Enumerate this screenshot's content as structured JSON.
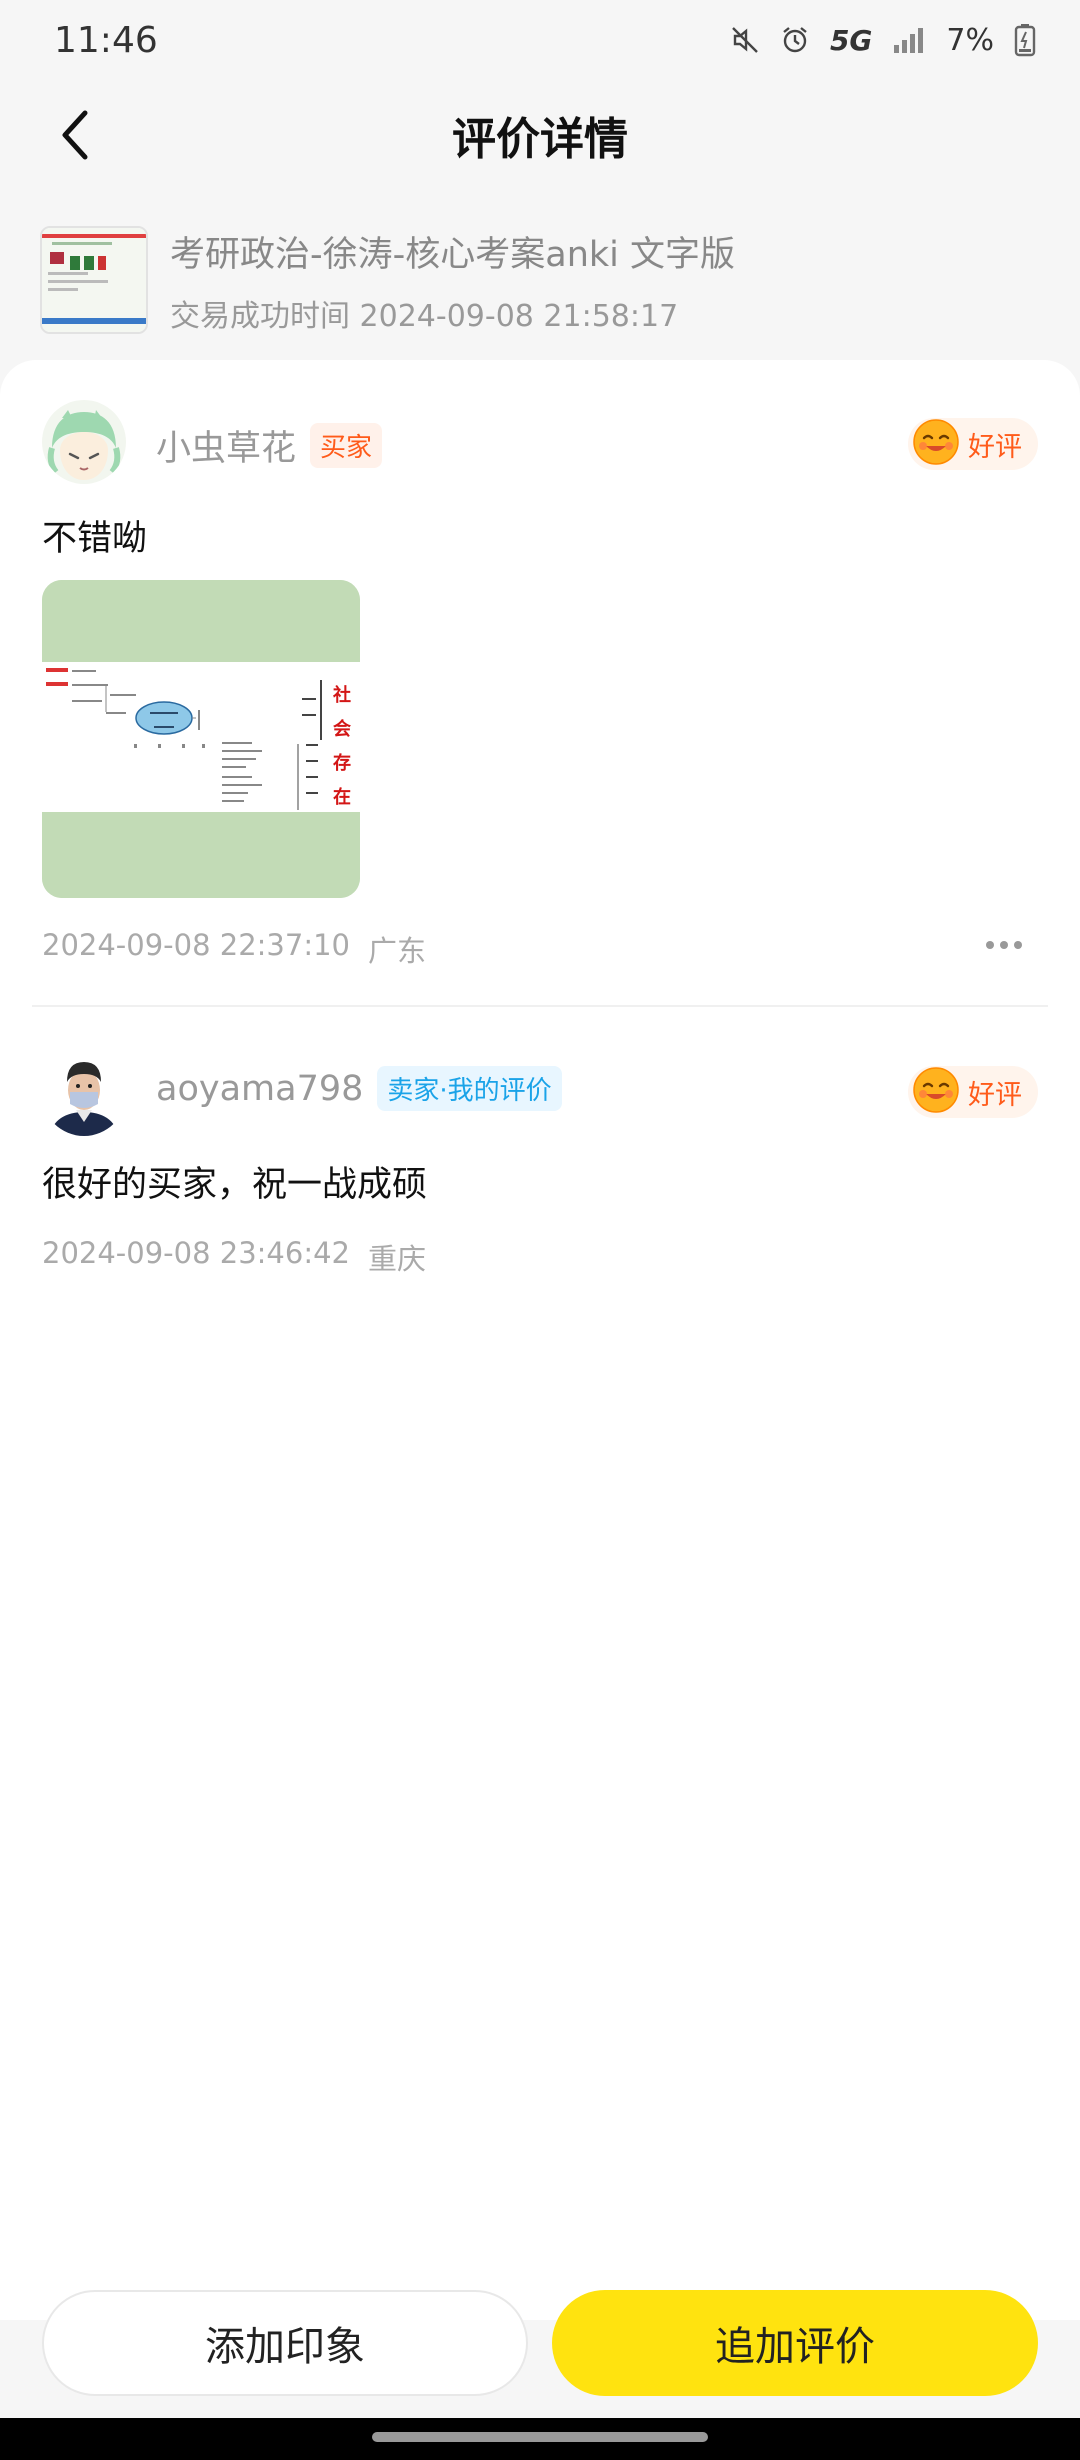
{
  "status_bar": {
    "time": "11:46",
    "network": "5G",
    "battery": "7%",
    "icons": [
      "mute-icon",
      "alarm-icon",
      "signal-icon",
      "battery-icon"
    ]
  },
  "nav": {
    "title": "评价详情",
    "back_icon": "chevron-left-icon"
  },
  "product": {
    "name": "考研政治-徐涛-核心考案anki 文字版",
    "trade_time_label": "交易成功时间",
    "trade_time": "2024-09-08 21:58:17"
  },
  "reviews": [
    {
      "username": "小虫草花",
      "role": "买家",
      "rating": "好评",
      "content": "不错呦",
      "has_image": true,
      "image_text": [
        "社",
        "会",
        "存",
        "在"
      ],
      "time": "2024-09-08 22:37:10",
      "location": "广东"
    },
    {
      "username": "aoyama798",
      "role": "卖家·我的评价",
      "rating": "好评",
      "content": "很好的买家，祝一战成硕",
      "has_image": false,
      "time": "2024-09-08 23:46:42",
      "location": "重庆"
    }
  ],
  "actions": {
    "add_impression": "添加印象",
    "append_review": "追加评价"
  },
  "colors": {
    "accent_yellow": "#ffe30f",
    "rating_orange": "#ff5b1a",
    "seller_blue": "#1aa3e8"
  }
}
